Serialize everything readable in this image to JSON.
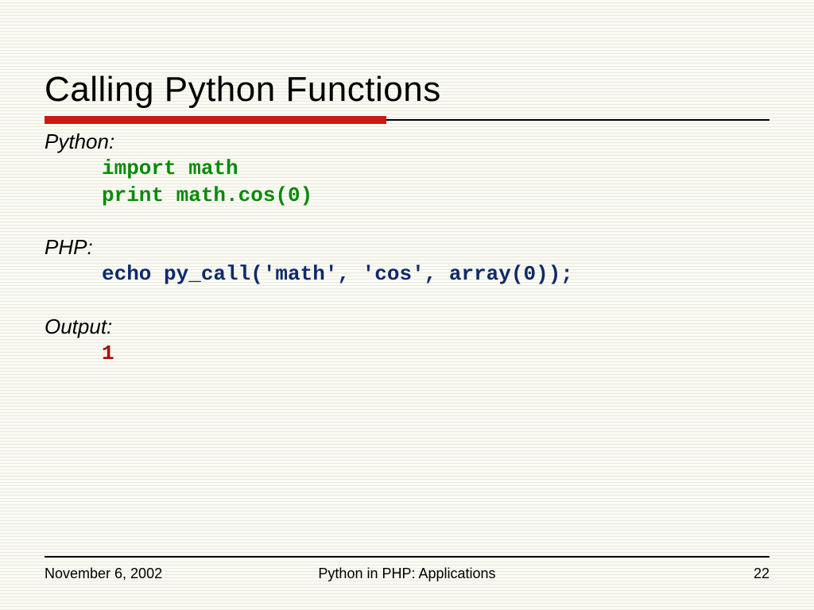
{
  "title": "Calling Python Functions",
  "sections": {
    "python": {
      "label": "Python:",
      "code1": "import math",
      "code2": "print math.cos(0)"
    },
    "php": {
      "label": "PHP:",
      "code": "echo py_call('math', 'cos', array(0));"
    },
    "output": {
      "label": "Output:",
      "value": "1"
    }
  },
  "footer": {
    "date": "November 6, 2002",
    "title": "Python in PHP: Applications",
    "page": "22"
  }
}
